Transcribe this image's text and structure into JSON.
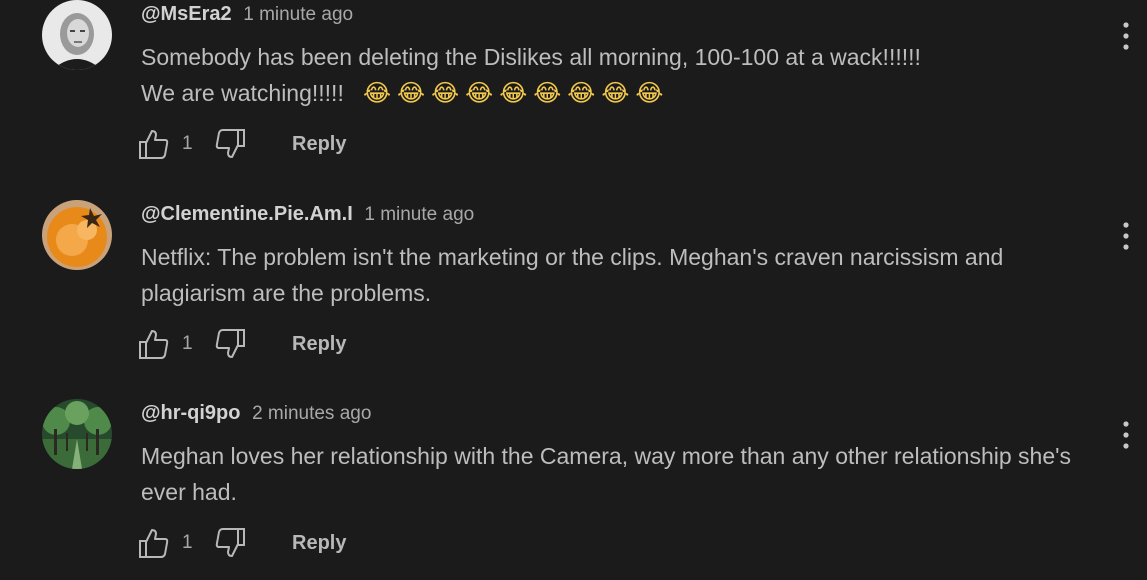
{
  "comments": [
    {
      "author": "@MsEra2",
      "time": "1 minute ago",
      "text": "Somebody has been deleting the Dislikes all morning, 100-100 at a wack!!!!!!\nWe are watching!!!!!   ",
      "emoji": "😂😂😂😂😂😂😂😂😂",
      "likes": "1",
      "reply_label": "Reply",
      "avatar": "woman-portrait-avatar"
    },
    {
      "author": "@Clementine.Pie.Am.I",
      "time": "1 minute ago",
      "text": "Netflix: The problem isn't the marketing or the clips. Meghan's craven narcissism and plagiarism are the problems.",
      "emoji": "",
      "likes": "1",
      "reply_label": "Reply",
      "avatar": "orange-pie-avatar"
    },
    {
      "author": "@hr-qi9po",
      "time": "2 minutes ago",
      "text": "Meghan loves her relationship with the Camera, way more than any other relationship she's ever had.",
      "emoji": "",
      "likes": "1",
      "reply_label": "Reply",
      "avatar": "tree-avenue-avatar"
    }
  ],
  "colors": {
    "background": "#1b1b1b",
    "text": "#bdbdbd",
    "author": "#d2d2d2"
  }
}
